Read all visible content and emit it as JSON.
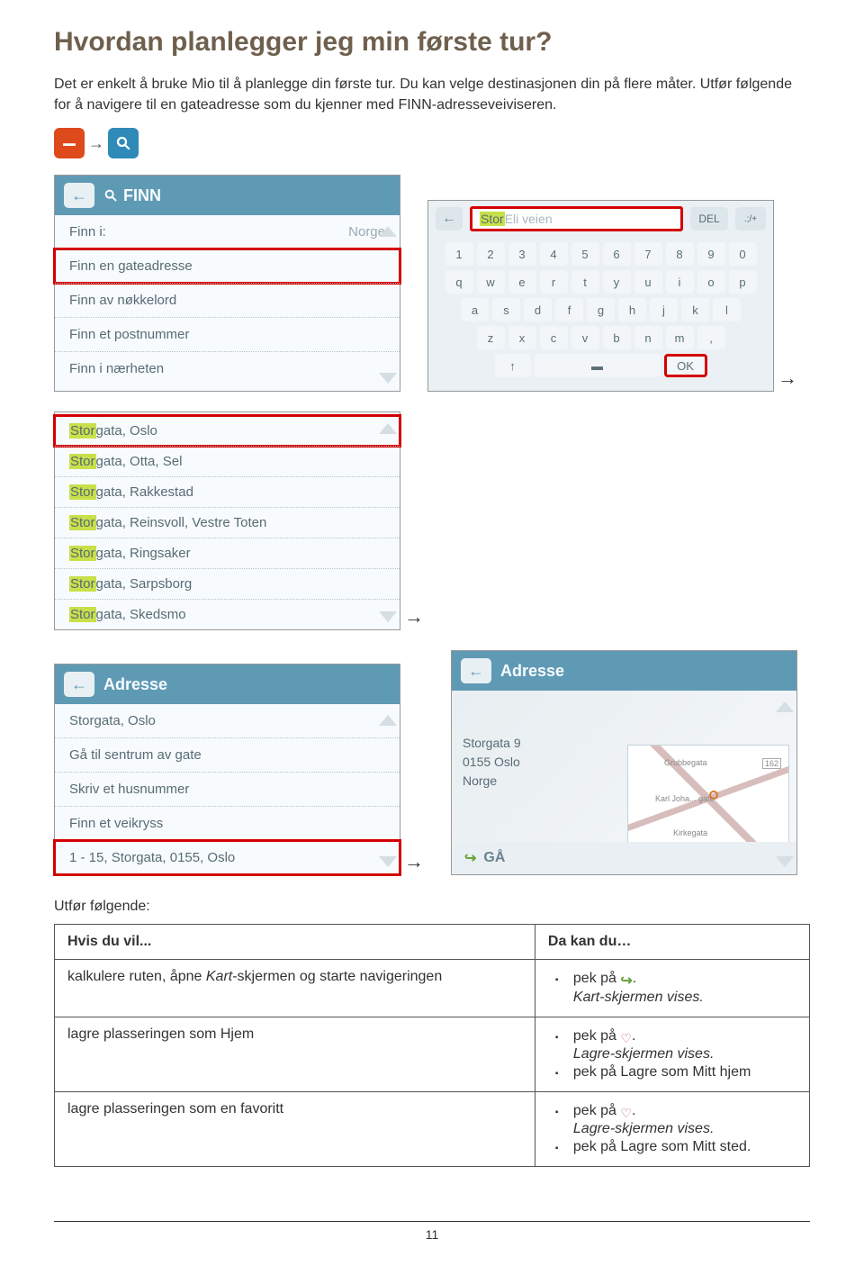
{
  "heading": "Hvordan planlegger jeg min første tur?",
  "intro": "Det er enkelt å bruke Mio til å planlegge din første tur. Du kan velge destinasjonen din på flere måter. Utfør følgende for å navigere til en gateadresse som du kjenner med FINN-adresseveiviseren.",
  "shot1": {
    "title": "FINN",
    "row1_label": "Finn i:",
    "row1_value": "Norge",
    "row2": "Finn en gateadresse",
    "row3": "Finn av nøkkelord",
    "row4": "Finn et postnummer",
    "row5": "Finn i nærheten"
  },
  "shot2": {
    "typed_hl": "Stor",
    "typed_rest": " Eli veien",
    "del": "DEL",
    "sym": ".;/+",
    "numrow": [
      "1",
      "2",
      "3",
      "4",
      "5",
      "6",
      "7",
      "8",
      "9",
      "0"
    ],
    "qrow": [
      "q",
      "w",
      "e",
      "r",
      "t",
      "y",
      "u",
      "i",
      "o",
      "p"
    ],
    "arow": [
      "a",
      "s",
      "d",
      "f",
      "g",
      "h",
      "j",
      "k",
      "l"
    ],
    "zrow": [
      "z",
      "x",
      "c",
      "v",
      "b",
      "n",
      "m",
      ","
    ],
    "shift": "↑",
    "ok": "OK"
  },
  "shot3": {
    "items": [
      {
        "hl": "Stor",
        "rest": "gata, Oslo"
      },
      {
        "hl": "Stor",
        "rest": "gata, Otta, Sel"
      },
      {
        "hl": "Stor",
        "rest": "gata, Rakkestad"
      },
      {
        "hl": "Stor",
        "rest": "gata, Reinsvoll, Vestre Toten"
      },
      {
        "hl": "Stor",
        "rest": "gata, Ringsaker"
      },
      {
        "hl": "Stor",
        "rest": "gata, Sarpsborg"
      },
      {
        "hl": "Stor",
        "rest": "gata, Skedsmo"
      }
    ]
  },
  "shot4": {
    "title": "Adresse",
    "r1": "Storgata, Oslo",
    "r2": "Gå til sentrum av gate",
    "r3": "Skriv et husnummer",
    "r4": "Finn et veikryss",
    "r5": "1 - 15, Storgata, 0155, Oslo"
  },
  "shot5": {
    "title": "Adresse",
    "line1": "Storgata 9",
    "line2": "0155 Oslo",
    "line3": "Norge",
    "map_l1": "Grubbegata",
    "map_badge": "162",
    "map_l2": "Karl Joha... gate",
    "map_l3": "Kirkegata",
    "go": "GÅ"
  },
  "section_label": "Utfør følgende:",
  "table": {
    "h1": "Hvis du vil...",
    "h2": "Da kan du…",
    "r1_left": "kalkulere ruten, åpne Kart-skjermen og starte navigeringen",
    "r1_b1a": "pek på ",
    "r1_b1b": ".",
    "r1_b2": "Kart-skjermen vises.",
    "r2_left": "lagre plasseringen som Hjem",
    "r2_b1a": "pek på ",
    "r2_b1b": ".",
    "r2_b2": "Lagre-skjermen vises.",
    "r2_b3": "pek på Lagre som Mitt hjem",
    "r3_left": "lagre plasseringen som en favoritt",
    "r3_b1a": "pek på ",
    "r3_b1b": ".",
    "r3_b2": "Lagre-skjermen vises.",
    "r3_b3": "pek på Lagre som Mitt sted."
  },
  "pagenum": "11"
}
